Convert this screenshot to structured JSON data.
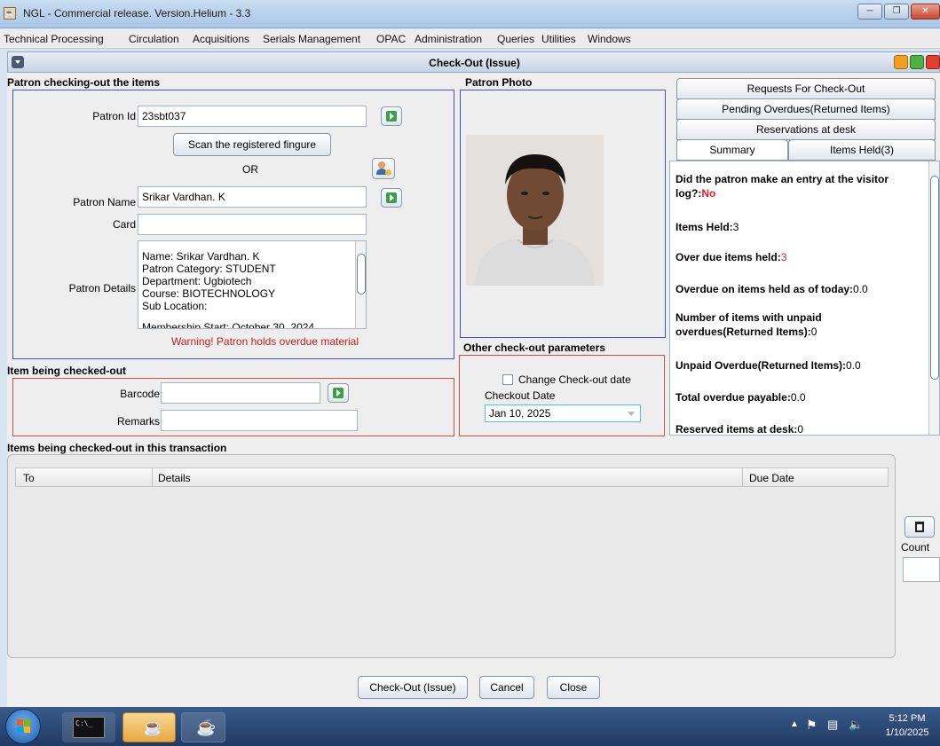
{
  "window": {
    "title": "NGL - Commercial release. Version.Helium - 3.3"
  },
  "menu": [
    "Technical Processing",
    "Circulation",
    "Acquisitions",
    "Serials Management",
    "OPAC",
    "Administration",
    "Queries",
    "Utilities",
    "Windows"
  ],
  "frame": {
    "title": "Check-Out (Issue)"
  },
  "patron_section": {
    "heading": "Patron checking-out the items",
    "patron_id_label": "Patron Id",
    "patron_id_value": "23sbt037",
    "scan_button": "Scan the registered fingure",
    "or_label": "OR",
    "patron_name_label": "Patron Name",
    "patron_name_value": "Srikar Vardhan. K",
    "card_label": "Card",
    "card_value": "",
    "details_label": "Patron Details",
    "details_lines": [
      "Name: Srikar Vardhan. K",
      "Patron Category: STUDENT",
      "Department: Ugbiotech",
      "Course: BIOTECHNOLOGY",
      "Sub Location:",
      "Membership Start: October 30, 2024"
    ],
    "warning": "Warning! Patron holds overdue material"
  },
  "photo_section": {
    "heading": "Patron Photo"
  },
  "item_section": {
    "heading": "Item being checked-out",
    "barcode_label": "Barcode",
    "barcode_value": "",
    "remarks_label": "Remarks",
    "remarks_value": ""
  },
  "params_section": {
    "heading": "Other check-out parameters",
    "change_date_label": "Change Check-out date",
    "change_date_checked": false,
    "checkout_date_label": "Checkout Date",
    "checkout_date_value": "Jan 10, 2025"
  },
  "tabs": {
    "row1": "Requests For Check-Out",
    "row2": "Pending Overdues(Returned Items)",
    "row3": "Reservations at desk",
    "summary": "Summary",
    "items_held": "Items Held(3)"
  },
  "summary": {
    "visitor_log_label": "Did the patron make an entry at the visitor log?:",
    "visitor_log_value": "No",
    "items_held_label": "Items Held:",
    "items_held_value": "3",
    "overdue_items_label": "Over due items held:",
    "overdue_items_value": "3",
    "overdue_today_label": "Overdue on items held as of today:",
    "overdue_today_value": "0.0",
    "unpaid_items_label": "Number of items with unpaid overdues(Returned Items):",
    "unpaid_items_value": "0",
    "unpaid_overdue_label": "Unpaid Overdue(Returned Items):",
    "unpaid_overdue_value": "0.0",
    "total_payable_label": "Total overdue payable:",
    "total_payable_value": "0.0",
    "reserved_label": "Reserved items at desk:",
    "reserved_value": "0"
  },
  "transaction_section": {
    "heading": "Items being checked-out in this transaction",
    "columns": [
      "To",
      "Details",
      "Due Date"
    ],
    "count_label": "Count",
    "count_value": ""
  },
  "buttons": {
    "checkout": "Check-Out (Issue)",
    "cancel": "Cancel",
    "close": "Close"
  },
  "taskbar": {
    "time": "5:12 PM",
    "date": "1/10/2025",
    "cmd_label": "C:\\_"
  },
  "colors": {
    "warning": "#c02020",
    "red_value": "#e0202a",
    "blue_border": "#4b4fbf",
    "red_border": "#d94a4a"
  }
}
